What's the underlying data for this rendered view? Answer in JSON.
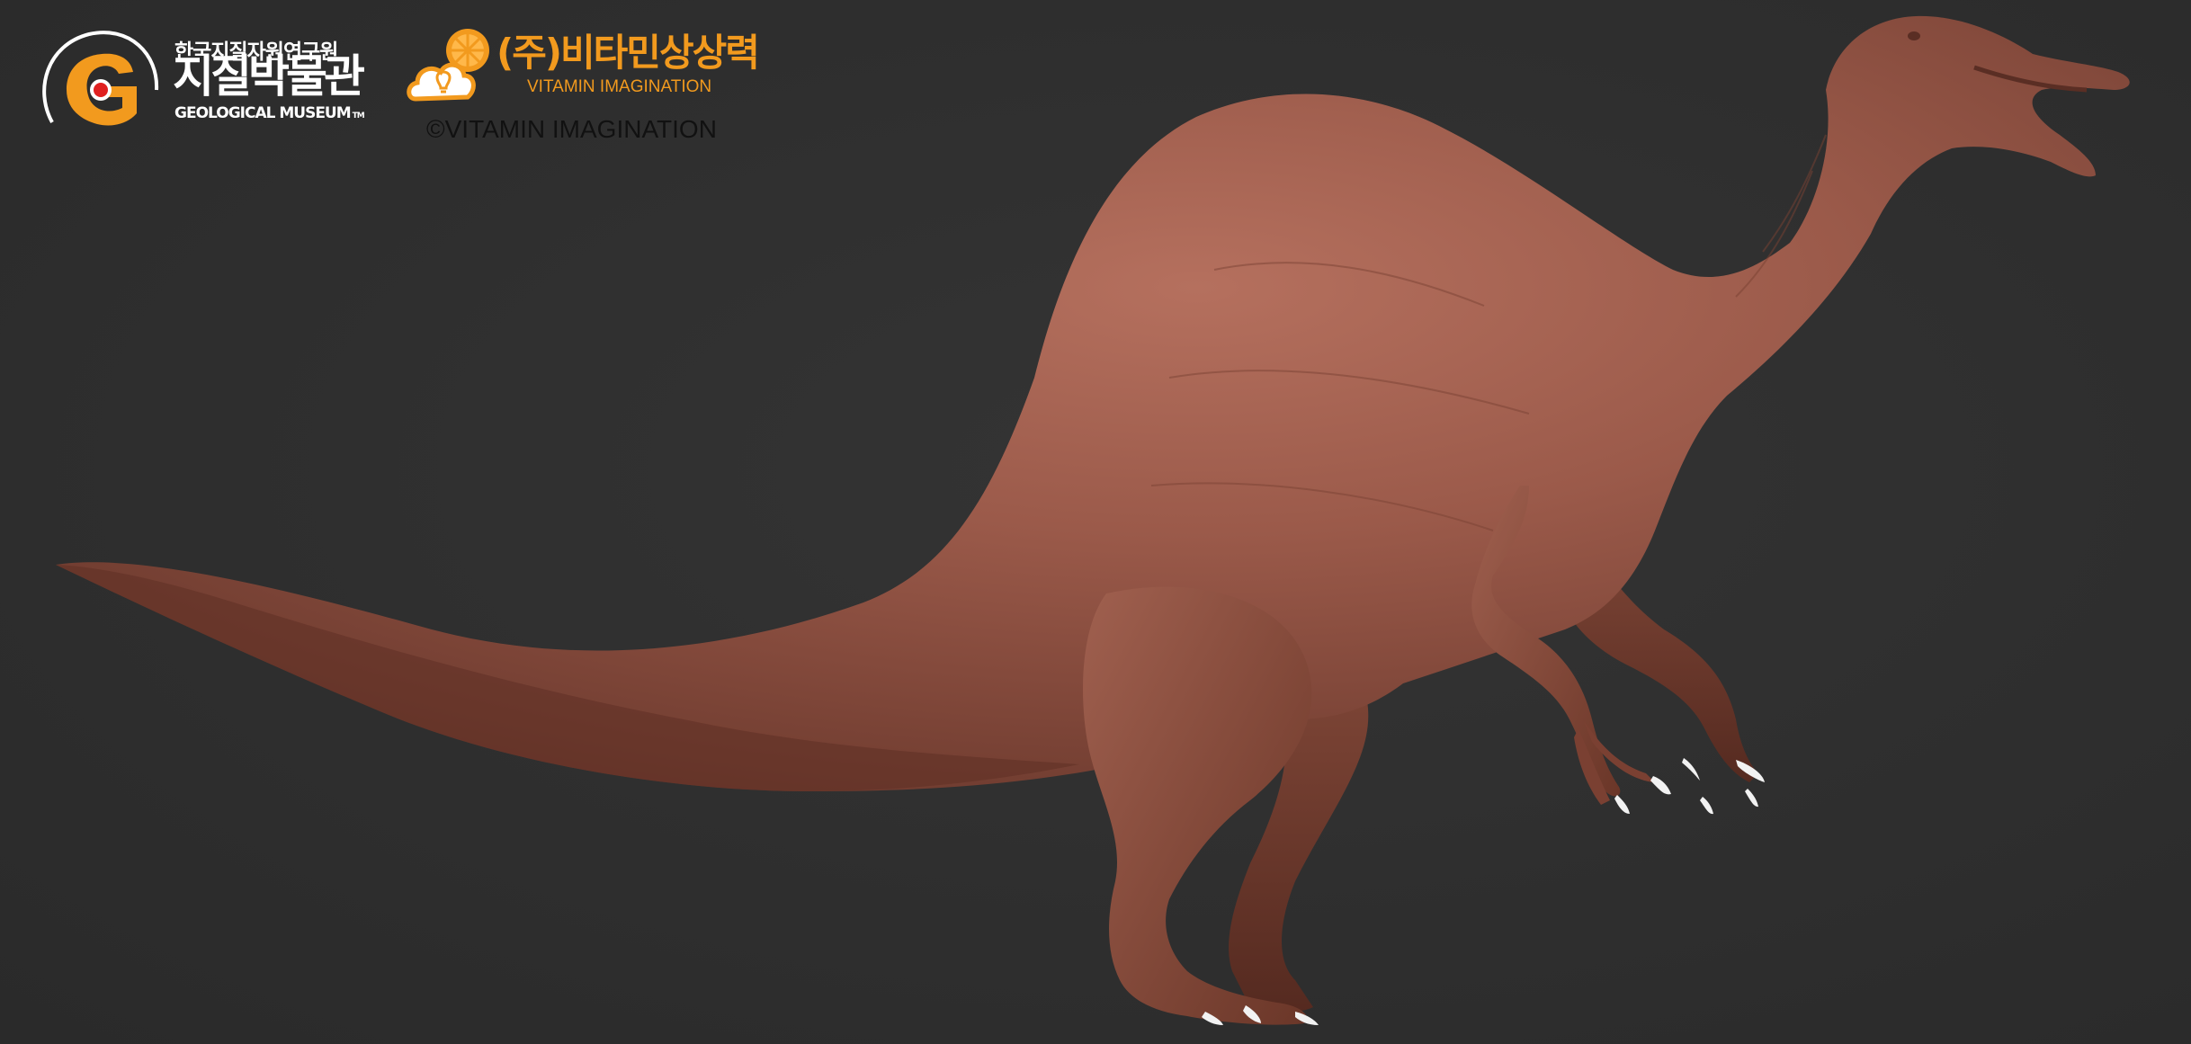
{
  "colors": {
    "background": "#2f2f2f",
    "brand_orange": "#f29a1e",
    "skin": "#9a5a4a",
    "claws": "#f2f2f2",
    "logo_red": "#e02020"
  },
  "geo_museum_logo": {
    "korean_institute": "한국지질자원연구원",
    "korean_name": "지질박물관",
    "english_name": "GEOLOGICAL MUSEUM",
    "trademark": "TM",
    "icon": "geological-museum-g-icon"
  },
  "vitamin_logo": {
    "korean_name": "(주)비타민상상력",
    "english_name": "VITAMIN IMAGINATION",
    "icon": "orange-lightbulb-cloud-icon"
  },
  "copyright": "©VITAMIN IMAGINATION",
  "subject": {
    "icon": "sail-backed-dinosaur-sculpture"
  }
}
